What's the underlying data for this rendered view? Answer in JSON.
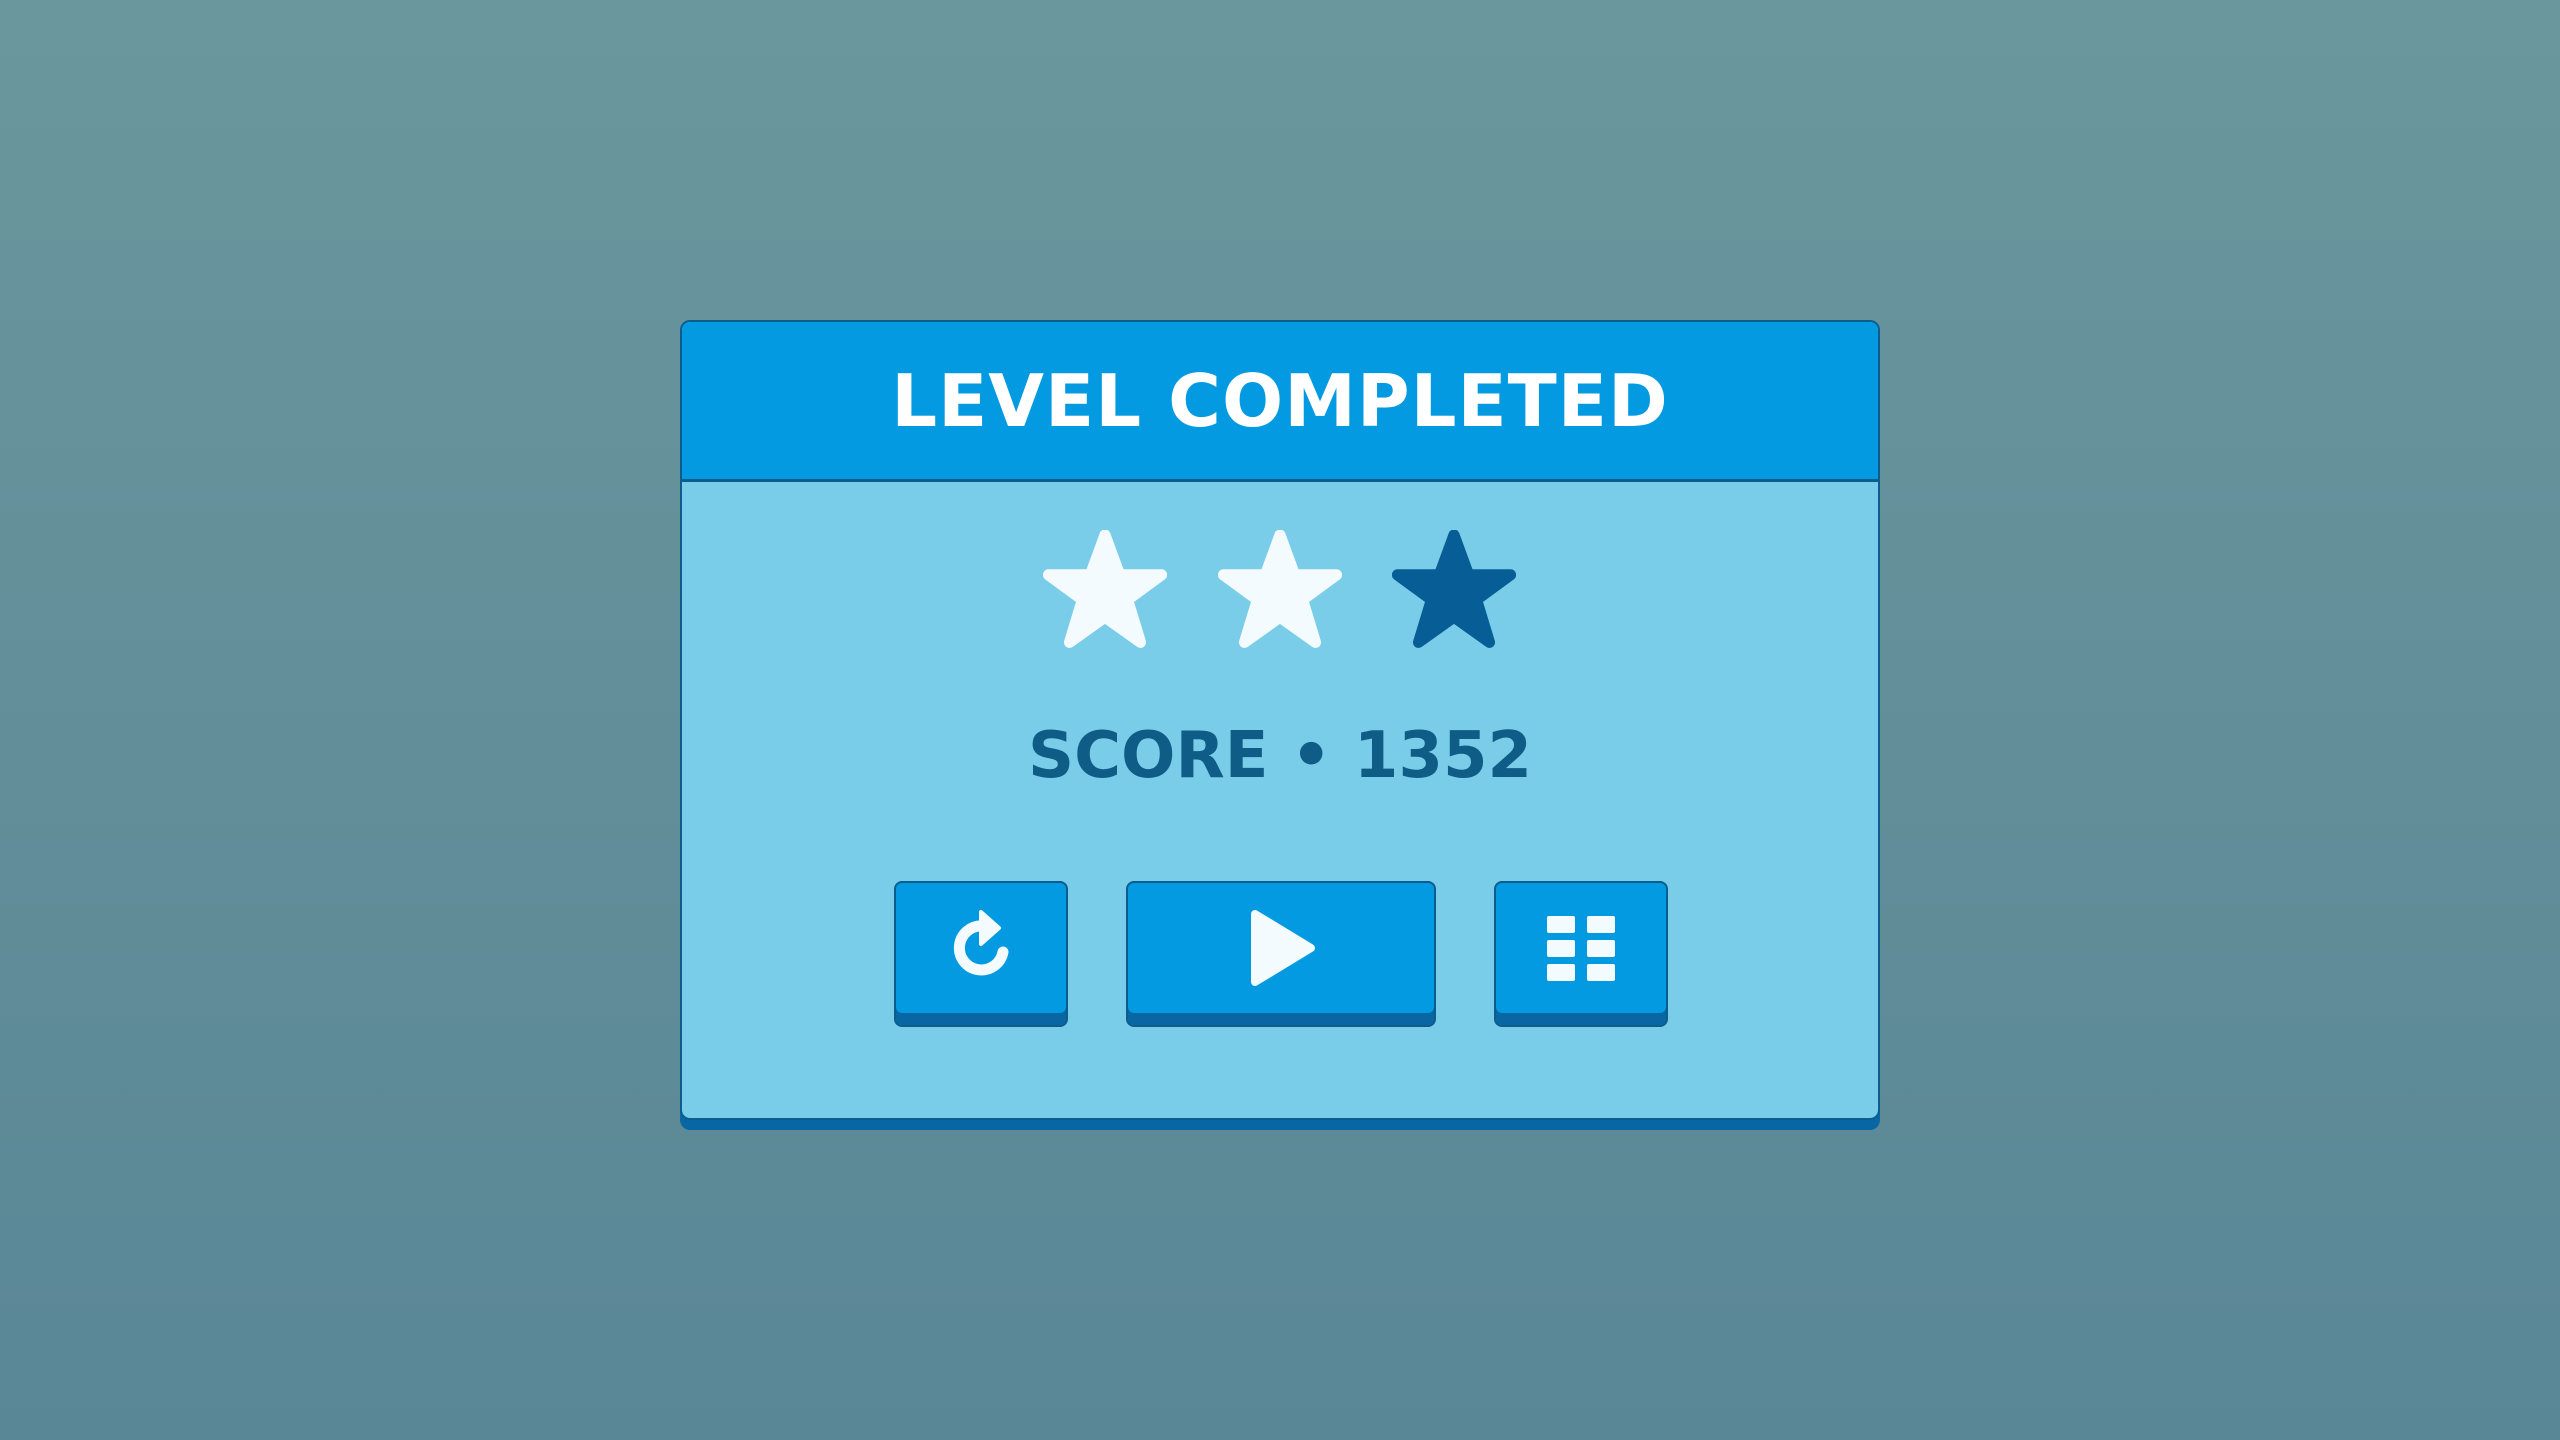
{
  "panel": {
    "title": "LEVEL COMPLETED"
  },
  "rating": {
    "earned_stars": 2,
    "total_stars": 3,
    "filled_color": "#f4fbff",
    "empty_color": "#075d95"
  },
  "score": {
    "text": "SCORE • 1352"
  },
  "buttons": {
    "replay_icon": "replay-icon",
    "play_icon": "play-icon",
    "levels_icon": "grid-icon"
  },
  "colors": {
    "background": "#6a969d",
    "panel": "#7acde8",
    "header": "#039ae2",
    "button": "#039ae2",
    "button_shadow": "#0867a3",
    "score_text": "#0f5c86"
  }
}
